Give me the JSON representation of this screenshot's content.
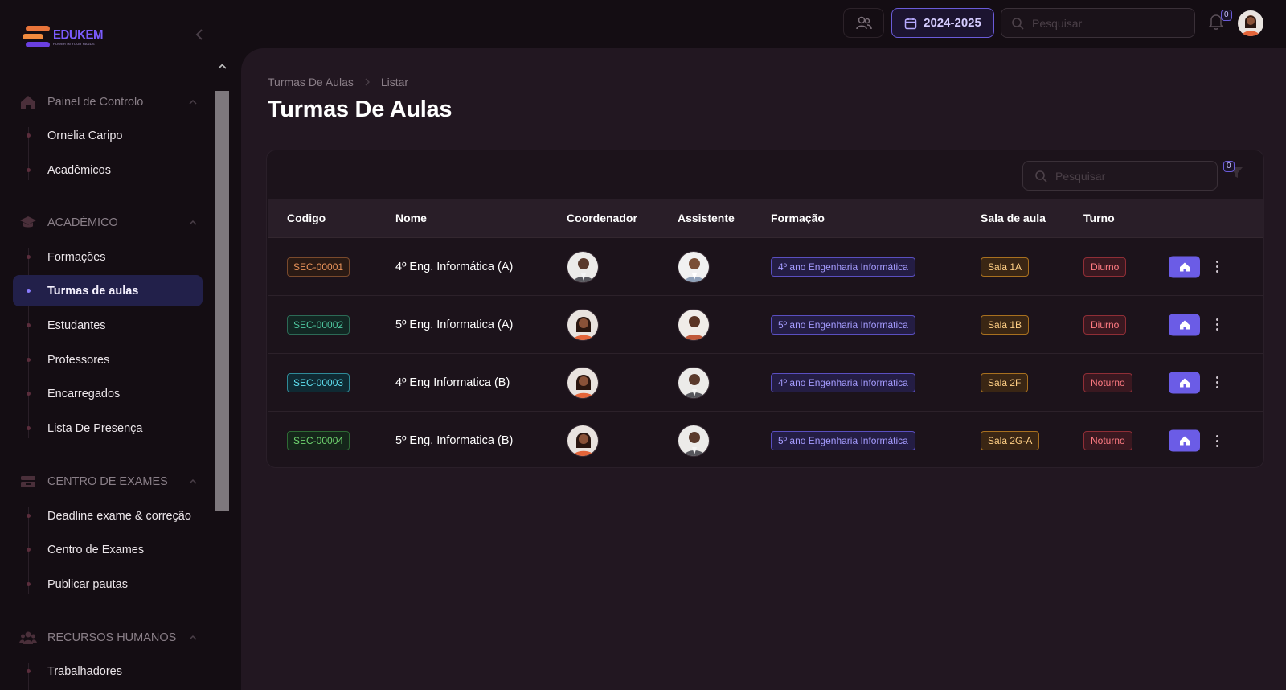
{
  "app": {
    "logo_name": "EDUKEM",
    "logo_tagline": "POWER IN YOUR HANDS"
  },
  "topbar": {
    "year_label": "2024-2025",
    "search_placeholder": "Pesquisar",
    "notifications_count": "0"
  },
  "sidebar": {
    "sections": [
      {
        "label": "Painel de Controlo",
        "icon": "home-icon",
        "items": [
          {
            "label": "Ornelia Caripo"
          },
          {
            "label": "Acadêmicos"
          }
        ]
      },
      {
        "label": "ACADÉMICO",
        "icon": "graduation-cap-icon",
        "items": [
          {
            "label": "Formações"
          },
          {
            "label": "Turmas de aulas",
            "active": true
          },
          {
            "label": "Estudantes"
          },
          {
            "label": "Professores"
          },
          {
            "label": "Encarregados"
          },
          {
            "label": "Lista De Presença"
          }
        ]
      },
      {
        "label": "CENTRO DE EXAMES",
        "icon": "exam-icon",
        "items": [
          {
            "label": "Deadline exame & correção"
          },
          {
            "label": "Centro de Exames"
          },
          {
            "label": "Publicar pautas"
          }
        ]
      },
      {
        "label": "RECURSOS HUMANOS",
        "icon": "people-icon",
        "items": [
          {
            "label": "Trabalhadores"
          }
        ]
      }
    ]
  },
  "main": {
    "breadcrumb": [
      "Turmas De Aulas",
      "Listar"
    ],
    "title": "Turmas De Aulas",
    "search_placeholder": "Pesquisar",
    "filter_count": "0",
    "columns": [
      "Codigo",
      "Nome",
      "Coordenador",
      "Assistente",
      "Formação",
      "Sala de aula",
      "Turno"
    ],
    "rows": [
      {
        "codigo": "SEC-00001",
        "nome": "4º Eng. Informática (A)",
        "formacao": "4º ano Engenharia Informática",
        "sala": "Sala 1A",
        "turno": "Diurno"
      },
      {
        "codigo": "SEC-00002",
        "nome": "5º Eng. Informatica (A)",
        "formacao": "5º ano Engenharia Informática",
        "sala": "Sala 1B",
        "turno": "Diurno"
      },
      {
        "codigo": "SEC-00003",
        "nome": "4º Eng Informatica (B)",
        "formacao": "4º ano Engenharia Informática",
        "sala": "Sala 2F",
        "turno": "Noturno"
      },
      {
        "codigo": "SEC-00004",
        "nome": "5º Eng. Informatica (B)",
        "formacao": "5º ano Engenharia Informática",
        "sala": "Sala 2G-A",
        "turno": "Noturno"
      }
    ]
  },
  "colors": {
    "accent": "#6b5ce6",
    "code_colors": [
      "#e8935a",
      "#4fc7a0",
      "#5fe0f0",
      "#6fd36f"
    ],
    "code_bg": [
      "#2a1a14",
      "#122723",
      "#0f2a33",
      "#15261a"
    ],
    "code_border": [
      "#7a4a2c",
      "#2c6a56",
      "#2f8a98",
      "#2e6a34"
    ]
  }
}
